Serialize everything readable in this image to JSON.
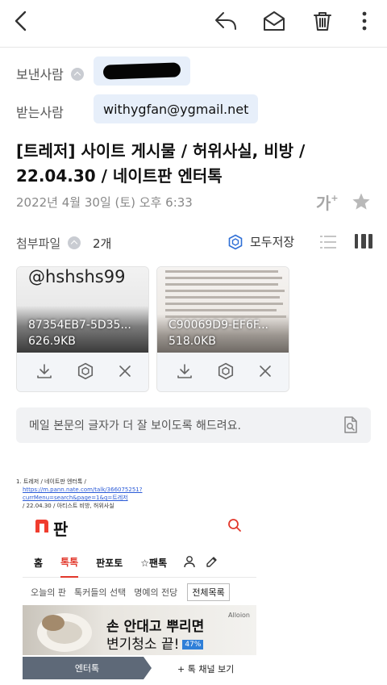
{
  "toolbar": {
    "back_icon": "chevron-left-icon",
    "reply_icon": "reply-icon",
    "mark_unread_icon": "envelope-open-icon",
    "delete_icon": "trash-icon",
    "more_icon": "more-vertical-icon"
  },
  "header": {
    "sender_label": "보낸사람",
    "recipient_label": "받는사람",
    "recipient_email": "withygfan@ygmail.net",
    "subject_line1": "[트레저] 사이트 게시물 / 허위사실, 비방 /",
    "subject_line2": "22.04.30 / 네이트판 엔터톡",
    "date": "2022년 4월 30일 (토) 오후 6:33",
    "font_size_glyph": "가"
  },
  "attachments": {
    "label": "첨부파일",
    "count": "2개",
    "save_all": "모두저장",
    "items": [
      {
        "thumb_text": "@hshshs99",
        "name": "87354EB7-5D35...",
        "size": "626.9KB"
      },
      {
        "name": "C90069D9-EF6F...",
        "size": "518.0KB"
      }
    ]
  },
  "hint": {
    "text": "메일 본문의 글자가 더 잘 보이도록 해드려요."
  },
  "body": {
    "line1": "1. 트레저 / 네이트판 엔터톡 /",
    "link1": "https://m.pann.nate.com/talk/366075251?",
    "link2": "currMenu=search&page=1&q=트레저",
    "line4": "/ 22.04.30 / 아티스트 비방, 허위사실"
  },
  "nate": {
    "logo_text": "판",
    "tabs": [
      "홈",
      "톡톡",
      "판포토",
      "☆팬톡"
    ],
    "subtabs": [
      "오늘의 판",
      "톡커들의 선택",
      "명예의 전당",
      "전체목록"
    ],
    "ad_line1": "손 안대고 뿌리면",
    "ad_line2": "변기청소 끝!",
    "ad_badge": "47%",
    "ad_brand": "Alloion",
    "channel": "엔터톡",
    "more_channel": "+ 톡 채널 보기"
  },
  "colors": {
    "accent": "#e2382c",
    "chip_bg": "#e7effa",
    "icon": "#3a3a3a"
  }
}
